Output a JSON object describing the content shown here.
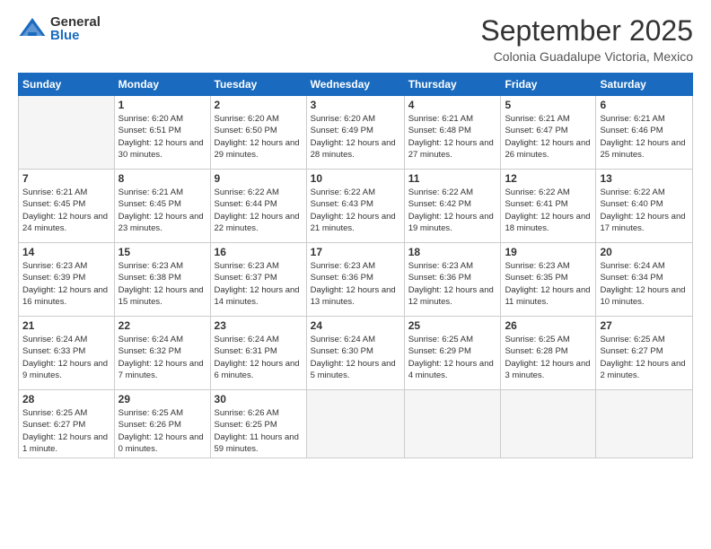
{
  "logo": {
    "general": "General",
    "blue": "Blue"
  },
  "title": "September 2025",
  "location": "Colonia Guadalupe Victoria, Mexico",
  "days_header": [
    "Sunday",
    "Monday",
    "Tuesday",
    "Wednesday",
    "Thursday",
    "Friday",
    "Saturday"
  ],
  "weeks": [
    [
      {
        "day": "",
        "empty": true
      },
      {
        "day": "1",
        "sunrise": "6:20 AM",
        "sunset": "6:51 PM",
        "daylight": "12 hours and 30 minutes."
      },
      {
        "day": "2",
        "sunrise": "6:20 AM",
        "sunset": "6:50 PM",
        "daylight": "12 hours and 29 minutes."
      },
      {
        "day": "3",
        "sunrise": "6:20 AM",
        "sunset": "6:49 PM",
        "daylight": "12 hours and 28 minutes."
      },
      {
        "day": "4",
        "sunrise": "6:21 AM",
        "sunset": "6:48 PM",
        "daylight": "12 hours and 27 minutes."
      },
      {
        "day": "5",
        "sunrise": "6:21 AM",
        "sunset": "6:47 PM",
        "daylight": "12 hours and 26 minutes."
      },
      {
        "day": "6",
        "sunrise": "6:21 AM",
        "sunset": "6:46 PM",
        "daylight": "12 hours and 25 minutes."
      }
    ],
    [
      {
        "day": "7",
        "sunrise": "6:21 AM",
        "sunset": "6:45 PM",
        "daylight": "12 hours and 24 minutes."
      },
      {
        "day": "8",
        "sunrise": "6:21 AM",
        "sunset": "6:45 PM",
        "daylight": "12 hours and 23 minutes."
      },
      {
        "day": "9",
        "sunrise": "6:22 AM",
        "sunset": "6:44 PM",
        "daylight": "12 hours and 22 minutes."
      },
      {
        "day": "10",
        "sunrise": "6:22 AM",
        "sunset": "6:43 PM",
        "daylight": "12 hours and 21 minutes."
      },
      {
        "day": "11",
        "sunrise": "6:22 AM",
        "sunset": "6:42 PM",
        "daylight": "12 hours and 19 minutes."
      },
      {
        "day": "12",
        "sunrise": "6:22 AM",
        "sunset": "6:41 PM",
        "daylight": "12 hours and 18 minutes."
      },
      {
        "day": "13",
        "sunrise": "6:22 AM",
        "sunset": "6:40 PM",
        "daylight": "12 hours and 17 minutes."
      }
    ],
    [
      {
        "day": "14",
        "sunrise": "6:23 AM",
        "sunset": "6:39 PM",
        "daylight": "12 hours and 16 minutes."
      },
      {
        "day": "15",
        "sunrise": "6:23 AM",
        "sunset": "6:38 PM",
        "daylight": "12 hours and 15 minutes."
      },
      {
        "day": "16",
        "sunrise": "6:23 AM",
        "sunset": "6:37 PM",
        "daylight": "12 hours and 14 minutes."
      },
      {
        "day": "17",
        "sunrise": "6:23 AM",
        "sunset": "6:36 PM",
        "daylight": "12 hours and 13 minutes."
      },
      {
        "day": "18",
        "sunrise": "6:23 AM",
        "sunset": "6:36 PM",
        "daylight": "12 hours and 12 minutes."
      },
      {
        "day": "19",
        "sunrise": "6:23 AM",
        "sunset": "6:35 PM",
        "daylight": "12 hours and 11 minutes."
      },
      {
        "day": "20",
        "sunrise": "6:24 AM",
        "sunset": "6:34 PM",
        "daylight": "12 hours and 10 minutes."
      }
    ],
    [
      {
        "day": "21",
        "sunrise": "6:24 AM",
        "sunset": "6:33 PM",
        "daylight": "12 hours and 9 minutes."
      },
      {
        "day": "22",
        "sunrise": "6:24 AM",
        "sunset": "6:32 PM",
        "daylight": "12 hours and 7 minutes."
      },
      {
        "day": "23",
        "sunrise": "6:24 AM",
        "sunset": "6:31 PM",
        "daylight": "12 hours and 6 minutes."
      },
      {
        "day": "24",
        "sunrise": "6:24 AM",
        "sunset": "6:30 PM",
        "daylight": "12 hours and 5 minutes."
      },
      {
        "day": "25",
        "sunrise": "6:25 AM",
        "sunset": "6:29 PM",
        "daylight": "12 hours and 4 minutes."
      },
      {
        "day": "26",
        "sunrise": "6:25 AM",
        "sunset": "6:28 PM",
        "daylight": "12 hours and 3 minutes."
      },
      {
        "day": "27",
        "sunrise": "6:25 AM",
        "sunset": "6:27 PM",
        "daylight": "12 hours and 2 minutes."
      }
    ],
    [
      {
        "day": "28",
        "sunrise": "6:25 AM",
        "sunset": "6:27 PM",
        "daylight": "12 hours and 1 minute."
      },
      {
        "day": "29",
        "sunrise": "6:25 AM",
        "sunset": "6:26 PM",
        "daylight": "12 hours and 0 minutes."
      },
      {
        "day": "30",
        "sunrise": "6:26 AM",
        "sunset": "6:25 PM",
        "daylight": "11 hours and 59 minutes."
      },
      {
        "day": "",
        "empty": true
      },
      {
        "day": "",
        "empty": true
      },
      {
        "day": "",
        "empty": true
      },
      {
        "day": "",
        "empty": true
      }
    ]
  ]
}
